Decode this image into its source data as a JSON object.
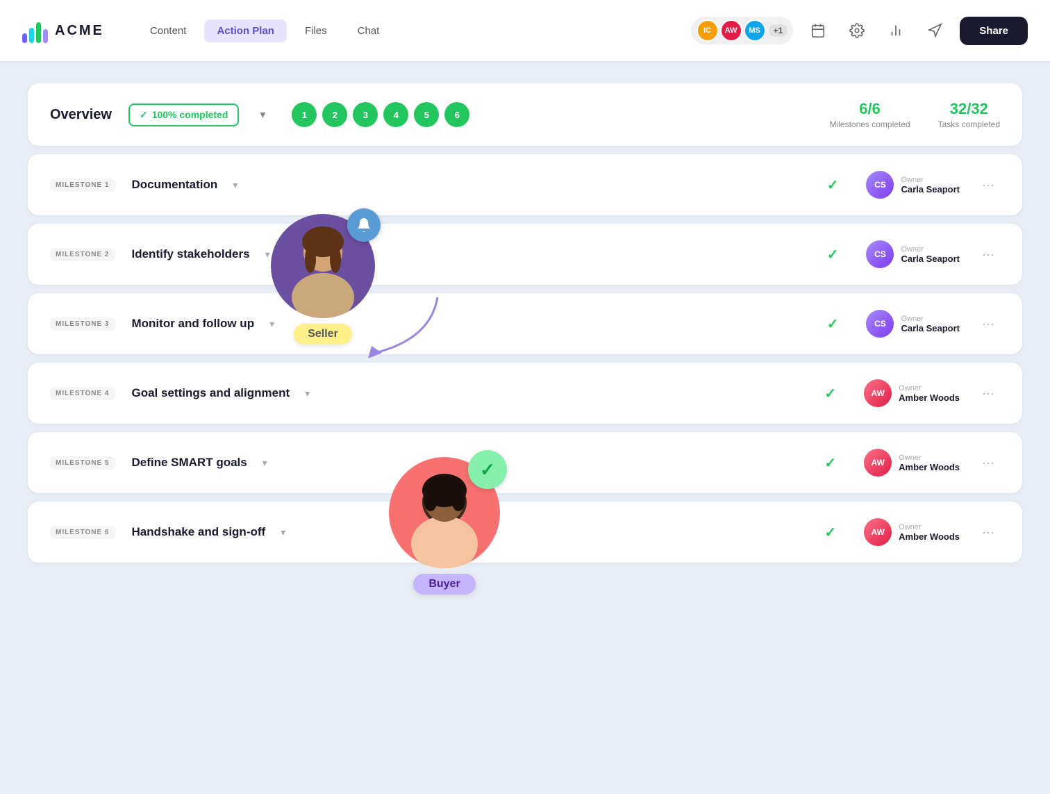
{
  "nav": {
    "logo_text": "ACME",
    "links": [
      {
        "label": "Content",
        "active": false
      },
      {
        "label": "Action Plan",
        "active": true
      },
      {
        "label": "Files",
        "active": false
      },
      {
        "label": "Chat",
        "active": false
      }
    ],
    "avatars": [
      {
        "initials": "IC",
        "color": "#f59e0b"
      },
      {
        "initials": "AW",
        "color": "#e11d48"
      },
      {
        "initials": "MS",
        "color": "#0ea5e9"
      }
    ],
    "plus_badge": "+1",
    "share_label": "Share"
  },
  "overview": {
    "title": "Overview",
    "completed_badge": "100% completed",
    "milestone_dots": [
      "1",
      "2",
      "3",
      "4",
      "5",
      "6"
    ],
    "milestones_completed": "6/6",
    "milestones_label": "Milestones completed",
    "tasks_completed": "32/32",
    "tasks_label": "Tasks completed"
  },
  "milestones": [
    {
      "tag": "MILESTONE 1",
      "title": "Documentation",
      "owner_label": "Owner",
      "owner_name": "Carla Seaport",
      "owner_type": "cs"
    },
    {
      "tag": "MILESTONE 2",
      "title": "Identify stakeholders",
      "owner_label": "Owner",
      "owner_name": "Carla Seaport",
      "owner_type": "cs"
    },
    {
      "tag": "MILESTONE 3",
      "title": "Monitor and follow up",
      "owner_label": "Owner",
      "owner_name": "Carla Seaport",
      "owner_type": "cs"
    },
    {
      "tag": "MILESTONE 4",
      "title": "Goal settings and alignment",
      "owner_label": "Owner",
      "owner_name": "Amber Woods",
      "owner_type": "aw"
    },
    {
      "tag": "MILESTONE 5",
      "title": "Define SMART goals",
      "owner_label": "Owner",
      "owner_name": "Amber Woods",
      "owner_type": "aw"
    },
    {
      "tag": "MILESTONE 6",
      "title": "Handshake and sign-off",
      "owner_label": "Owner",
      "owner_name": "Amber Woods",
      "owner_type": "aw"
    }
  ],
  "seller": {
    "label": "Seller"
  },
  "buyer": {
    "label": "Buyer"
  }
}
